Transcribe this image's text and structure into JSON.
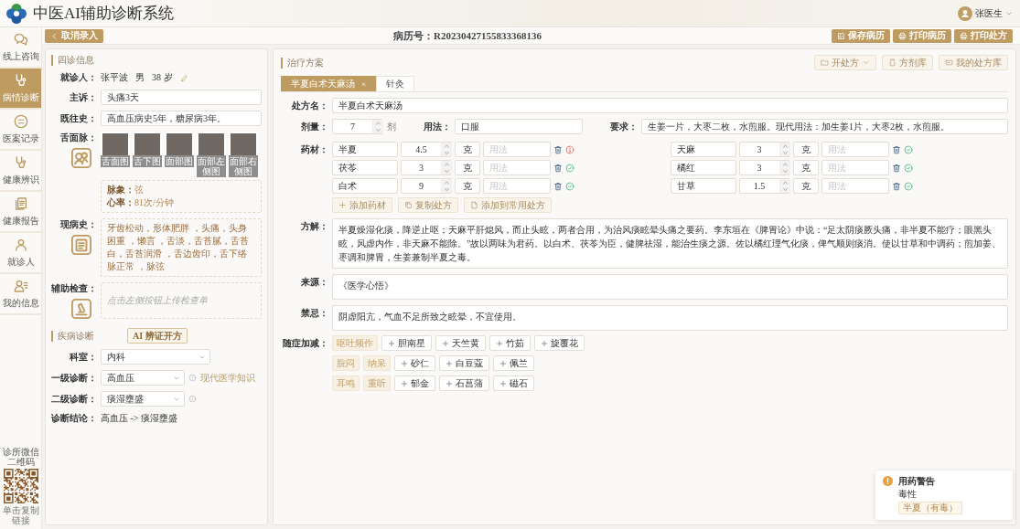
{
  "header": {
    "title": "中医AI辅助诊断系统",
    "user": "张医生"
  },
  "sidebar": {
    "items": [
      {
        "label": "线上咨询",
        "selected": false
      },
      {
        "label": "病情诊断",
        "selected": true
      },
      {
        "label": "医案记录",
        "selected": false
      },
      {
        "label": "健康辨识",
        "selected": false
      },
      {
        "label": "健康报告",
        "selected": false
      },
      {
        "label": "就诊人",
        "selected": false
      },
      {
        "label": "我的信息",
        "selected": false
      }
    ],
    "qr_caption": "诊所微信二维码",
    "qr_hint": "单击复制链接"
  },
  "toolbar": {
    "back": "取消录入",
    "record": "病历号：R20230427155833368136",
    "buttons": [
      "保存病历",
      "打印病历",
      "打印处方"
    ]
  },
  "four_exams": {
    "title": "四诊信息",
    "patient": {
      "label": "就诊人：",
      "name": "张平波",
      "sex": "男",
      "age": "38 岁"
    },
    "chief_complaint": {
      "label": "主诉：",
      "value": "头痛3天"
    },
    "history": {
      "label": "既往史：",
      "value": "高血压病史5年，糖尿病3年。"
    },
    "tongue_face_pulse": {
      "label": "舌面脉：",
      "photos": [
        "舌面图",
        "舌下图",
        "面部图",
        "面部左侧图",
        "面部右侧图"
      ],
      "pulse_label": "脉象：",
      "pulse": "弦",
      "heart_rate_label": "心率：",
      "heart_rate": "81次/分钟"
    },
    "present_illness": {
      "label": "现病史：",
      "value": "牙齿松动，形体肥胖 ，头痛，头身困重 ，懒言 ，舌淡，舌苔腻，舌苔白，舌苔润滑 ，舌边齿印，舌下络脉正常 ，脉弦"
    },
    "auxiliary_exam": {
      "label": "辅助检查：",
      "placeholder": "点击左侧按钮上传检查单"
    }
  },
  "diagnosis": {
    "title": "疾病诊断",
    "ai_button": "AI 辨证开方",
    "department": {
      "label": "科室：",
      "value": "内科"
    },
    "primary": {
      "label": "一级诊断：",
      "value": "高血压",
      "link": "现代医学知识"
    },
    "secondary": {
      "label": "二级诊断：",
      "value": "痰湿壅盛"
    },
    "conclusion": {
      "label": "诊断结论：",
      "value": "高血压 -> 痰湿壅盛"
    }
  },
  "treatment": {
    "title": "治疗方案",
    "actions": [
      {
        "label": "开处方",
        "kind": "dropdown"
      },
      {
        "label": "方剂库",
        "kind": "button"
      },
      {
        "label": "我的处方库",
        "kind": "button"
      }
    ],
    "tabs": [
      {
        "label": "半夏白术天麻汤",
        "close": "×",
        "selected": true
      },
      {
        "label": "针灸",
        "selected": false
      }
    ],
    "prescription": {
      "name_label": "处方名：",
      "name": "半夏白术天麻汤",
      "dose_label": "剂量：",
      "dose": "7",
      "dose_unit": "剂",
      "usage_label": "用法：",
      "usage": "口服",
      "requirement_label": "要求：",
      "requirement": "生姜一片，大枣二枚，水煎服。现代用法：加生姜1片，大枣2枚，水煎服。",
      "herbs_label": "药材：",
      "herbs": [
        {
          "name": "半夏",
          "amount": "4.5",
          "unit": "克",
          "usage": {
            "placeholder": "用法"
          },
          "warning": true
        },
        {
          "name": "天麻",
          "amount": "3",
          "unit": "克",
          "usage": {
            "placeholder": "用法"
          },
          "warning": false
        },
        {
          "name": "茯苓",
          "amount": "3",
          "unit": "克",
          "usage": {
            "placeholder": "用法"
          },
          "warning": false
        },
        {
          "name": "橘红",
          "amount": "3",
          "unit": "克",
          "usage": {
            "placeholder": "用法"
          },
          "warning": false
        },
        {
          "name": "白术",
          "amount": "9",
          "unit": "克",
          "usage": {
            "placeholder": "用法"
          },
          "warning": false
        },
        {
          "name": "甘草",
          "amount": "1.5",
          "unit": "克",
          "usage": {
            "placeholder": "用法"
          },
          "warning": false
        }
      ],
      "herb_buttons": [
        "添加药材",
        "复制处方",
        "添加到常用处方"
      ],
      "explanation_label": "方解：",
      "explanation": "半夏燥湿化痰，降逆止呕；天麻平肝熄风，而止头眩，两者合用，为治风痰眩晕头痛之要药。李东垣在《脾胃论》中说：“足太阴痰厥头痛，非半夏不能疗；眼黑头眩，风虚内作，非天麻不能除。”故以两味为君药。以白术、茯苓为臣，健脾祛湿，能治生痰之源。佐以橘红理气化痰，俾气顺则痰消。使以甘草和中调药；煎加姜、枣调和脾胃，生姜兼制半夏之毒。",
      "source_label": "来源：",
      "source": "《医学心悟》",
      "contraindication_label": "禁忌：",
      "contraindication": "阴虚阳亢，气血不足所致之眩晕，不宜使用。",
      "modifications_label": "随症加减：",
      "modifications": [
        {
          "symptoms": [
            "呕吐频作"
          ],
          "herbs": [
            "胆南星",
            "天竺黄",
            "竹茹",
            "旋覆花"
          ]
        },
        {
          "symptoms": [
            "脘闷",
            "纳呆"
          ],
          "herbs": [
            "砂仁",
            "白豆蔻",
            "佩兰"
          ]
        },
        {
          "symptoms": [
            "耳鸣",
            "重听"
          ],
          "herbs": [
            "郁金",
            "石菖蒲",
            "磁石"
          ]
        }
      ]
    }
  },
  "notification": {
    "title": "用药警告",
    "subtitle": "毒性",
    "tag": "半夏（有毒）"
  }
}
